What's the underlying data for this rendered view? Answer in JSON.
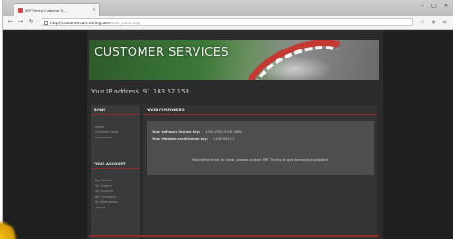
{
  "browser": {
    "tab_title": "SRT Timing Customer S...",
    "url_host": "http://customercare.timing.com",
    "url_path": "/cust_home.asp"
  },
  "site": {
    "banner_title": "CUSTOMER SERVICES",
    "ip_line": "Your IP address: 91.183.52.158"
  },
  "sidebar": {
    "home_heading": "HOME",
    "home_items": [
      "Home",
      "Firmware Area",
      "Downloads"
    ],
    "account_heading": "YOUR ACCOUNT",
    "account_items": [
      "My Details",
      "My Orders",
      "My Invoices",
      "My Contracts",
      "My Warranties",
      "Logout"
    ]
  },
  "main": {
    "heading": "YOUR CUSTOMERS",
    "contact_rows": [
      {
        "label": "Your software license key:",
        "value": "1000-2355-5347-2884"
      },
      {
        "label": "Your Member card license key:",
        "value": "1190-9547-7"
      }
    ],
    "notice": "Should there be an issue, please contact SRT Timing to get these keys updated."
  }
}
